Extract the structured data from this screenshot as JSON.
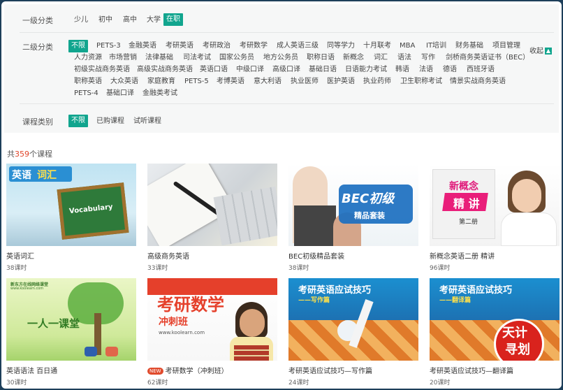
{
  "filters": {
    "level1": {
      "label": "一级分类",
      "options": [
        "少儿",
        "初中",
        "高中",
        "大学",
        "在职"
      ],
      "active": "在职"
    },
    "level2": {
      "label": "二级分类",
      "collapse_label": "收起",
      "collapse_icon": "chevron-up-icon",
      "rows": [
        [
          "不限",
          "PETS-3",
          "金融英语",
          "考研英语",
          "考研政治",
          "考研数学",
          "成人英语三级",
          "同等学力",
          "十月联考",
          "MBA",
          "IT培训",
          "财务基础",
          "项目管理"
        ],
        [
          "人力资源",
          "市场营销",
          "法律基础",
          "司法考试",
          "国家公务员",
          "地方公务员",
          "职称日语",
          "新概念",
          "词汇",
          "语法",
          "写作",
          "剑桥商务英语证书（BEC）"
        ],
        [
          "初级实战商务英语",
          "高级实战商务英语",
          "英语口语",
          "中级口译",
          "高级口译",
          "基础日语",
          "日语能力考试",
          "韩语",
          "法语",
          "德语",
          "西班牙语"
        ],
        [
          "职称英语",
          "大众英语",
          "家庭教育",
          "PETS-5",
          "考博英语",
          "意大利语",
          "执业医师",
          "医护英语",
          "执业药师",
          "卫生职称考试",
          "情景实战商务英语"
        ],
        [
          "PETS-4",
          "基础口译",
          "金融类考试"
        ]
      ],
      "active": "不限"
    },
    "course_type": {
      "label": "课程类别",
      "options": [
        "不限",
        "已购课程",
        "试听课程"
      ],
      "active": "不限"
    }
  },
  "results": {
    "prefix": "共",
    "count": "359",
    "suffix": "个课程"
  },
  "courses": [
    {
      "title": "英语词汇",
      "hours": "38课时",
      "thumb_text": [
        "英语",
        "词汇",
        "Vocabulary"
      ]
    },
    {
      "title": "高级商务英语",
      "hours": "33课时",
      "thumb_text": []
    },
    {
      "title": "BEC初级精品套装",
      "hours": "38课时",
      "thumb_text": [
        "BEC初级",
        "精品套装"
      ]
    },
    {
      "title": "新概念英语二册 精讲",
      "hours": "96课时",
      "thumb_text": [
        "新概念",
        "精 讲",
        "第二册"
      ]
    },
    {
      "title": "英语语法 百日通",
      "hours": "30课时",
      "thumb_text": [
        "新东方在线网络课堂",
        "www.koolearn.com",
        "一人一课堂"
      ]
    },
    {
      "title": "考研数学（冲刺班）",
      "hours": "62课时",
      "badge": "NEW",
      "thumb_text": [
        "考研数学",
        "冲刺班",
        "www.koolearn.com"
      ]
    },
    {
      "title": "考研英语应试技巧—写作篇",
      "hours": "24课时",
      "thumb_text": [
        "考研英语应试技巧",
        "——写作篇"
      ]
    },
    {
      "title": "考研英语应试技巧—翻译篇",
      "hours": "20课时",
      "thumb_text": [
        "考研英语应试技巧",
        "——翻译篇",
        "天计",
        "寻划"
      ]
    }
  ],
  "colors": {
    "accent": "#11a58e",
    "count_highlight": "#e0452a",
    "page_bg": "#1d3f5a"
  }
}
